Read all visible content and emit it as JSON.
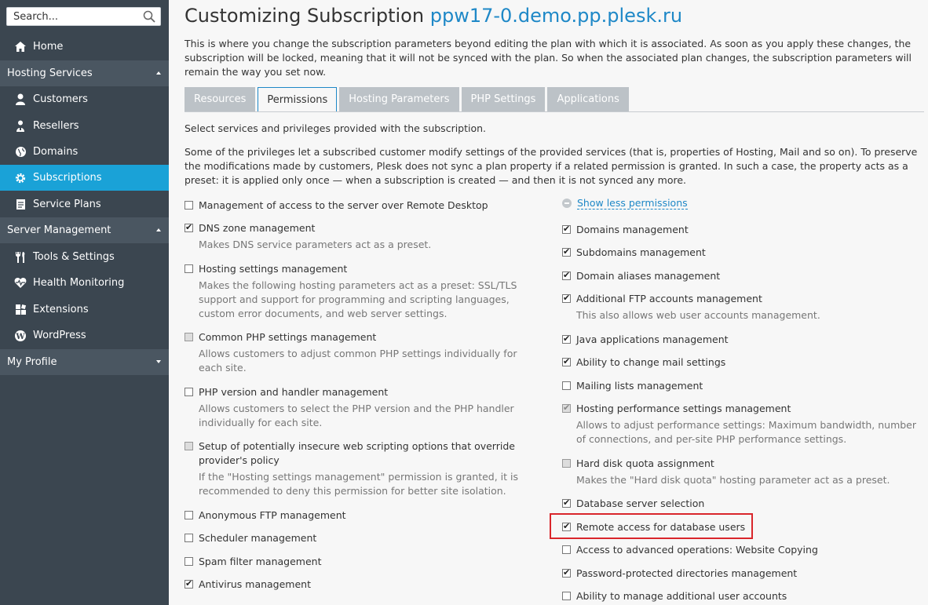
{
  "sidebar": {
    "search_placeholder": "Search...",
    "items": [
      {
        "label": "Home",
        "icon": "home-icon"
      },
      {
        "label": "Customers",
        "icon": "customer-icon"
      },
      {
        "label": "Resellers",
        "icon": "reseller-icon"
      },
      {
        "label": "Domains",
        "icon": "globe-icon"
      },
      {
        "label": "Subscriptions",
        "icon": "gear-icon"
      },
      {
        "label": "Service Plans",
        "icon": "document-icon"
      },
      {
        "label": "Tools & Settings",
        "icon": "tools-icon"
      },
      {
        "label": "Health Monitoring",
        "icon": "heart-icon"
      },
      {
        "label": "Extensions",
        "icon": "extensions-icon"
      },
      {
        "label": "WordPress",
        "icon": "wordpress-icon"
      }
    ],
    "sections": {
      "hosting": "Hosting Services",
      "server": "Server Management",
      "profile": "My Profile"
    },
    "active_color": "#1aa2d7"
  },
  "header": {
    "title_prefix": "Customizing Subscription",
    "title_domain": "ppw17-0.demo.pp.plesk.ru"
  },
  "intro": "This is where you change the subscription parameters beyond editing the plan with which it is associated. As soon as you apply these changes, the subscription will be locked, meaning that it will not be synced with the plan. So when the associated plan changes, the subscription parameters will remain the way you set now.",
  "tabs": [
    "Resources",
    "Permissions",
    "Hosting Parameters",
    "PHP Settings",
    "Applications"
  ],
  "active_tab": "Permissions",
  "permissions_intro": "Select services and privileges provided with the subscription.",
  "permissions_note": "Some of the privileges let a subscribed customer modify settings of the provided services (that is, properties of Hosting, Mail and so on). To preserve the modifications made by customers, Plesk does not sync a plan property if a related permission is granted. In such a case, the property acts as a preset: it is applied only once — when a subscription is created — and then it is not synced any more.",
  "show_less": "Show less permissions",
  "left_permissions": [
    {
      "label": "Management of access to the server over Remote Desktop",
      "checked": false,
      "disabled": false,
      "desc": ""
    },
    {
      "label": "DNS zone management",
      "checked": true,
      "disabled": false,
      "desc": "Makes DNS service parameters act as a preset."
    },
    {
      "label": "Hosting settings management",
      "checked": false,
      "disabled": false,
      "desc": "Makes the following hosting parameters act as a preset: SSL/TLS support and support for programming and scripting languages, custom error documents, and web server settings."
    },
    {
      "label": "Common PHP settings management",
      "checked": false,
      "disabled": true,
      "desc": "Allows customers to adjust common PHP settings individually for each site."
    },
    {
      "label": "PHP version and handler management",
      "checked": false,
      "disabled": false,
      "desc": "Allows customers to select the PHP version and the PHP handler individually for each site."
    },
    {
      "label": "Setup of potentially insecure web scripting options that override provider's policy",
      "checked": false,
      "disabled": true,
      "desc": "If the \"Hosting settings management\" permission is granted, it is recommended to deny this permission for better site isolation."
    },
    {
      "label": "Anonymous FTP management",
      "checked": false,
      "disabled": false,
      "desc": ""
    },
    {
      "label": "Scheduler management",
      "checked": false,
      "disabled": false,
      "desc": ""
    },
    {
      "label": "Spam filter management",
      "checked": false,
      "disabled": false,
      "desc": ""
    },
    {
      "label": "Antivirus management",
      "checked": true,
      "disabled": false,
      "desc": ""
    }
  ],
  "right_permissions": [
    {
      "label": "Domains management",
      "checked": true,
      "disabled": false,
      "desc": ""
    },
    {
      "label": "Subdomains management",
      "checked": true,
      "disabled": false,
      "desc": ""
    },
    {
      "label": "Domain aliases management",
      "checked": true,
      "disabled": false,
      "desc": ""
    },
    {
      "label": "Additional FTP accounts management",
      "checked": true,
      "disabled": false,
      "desc": "This also allows web user accounts management."
    },
    {
      "label": "Java applications management",
      "checked": true,
      "disabled": false,
      "desc": ""
    },
    {
      "label": "Ability to change mail settings",
      "checked": true,
      "disabled": false,
      "desc": ""
    },
    {
      "label": "Mailing lists management",
      "checked": false,
      "disabled": false,
      "desc": ""
    },
    {
      "label": "Hosting performance settings management",
      "checked": true,
      "disabled": true,
      "desc": "Allows to adjust performance settings: Maximum bandwidth, number of connections, and per-site PHP performance settings."
    },
    {
      "label": "Hard disk quota assignment",
      "checked": false,
      "disabled": true,
      "desc": "Makes the \"Hard disk quota\" hosting parameter act as a preset."
    },
    {
      "label": "Database server selection",
      "checked": true,
      "disabled": false,
      "desc": ""
    },
    {
      "label": "Remote access for database users",
      "checked": true,
      "disabled": false,
      "desc": ""
    },
    {
      "label": "Access to advanced operations: Website Copying",
      "checked": false,
      "disabled": false,
      "desc": ""
    },
    {
      "label": "Password-protected directories management",
      "checked": true,
      "disabled": false,
      "desc": ""
    },
    {
      "label": "Ability to manage additional user accounts",
      "checked": false,
      "disabled": false,
      "desc": ""
    }
  ],
  "highlight_color": "#d9262b"
}
